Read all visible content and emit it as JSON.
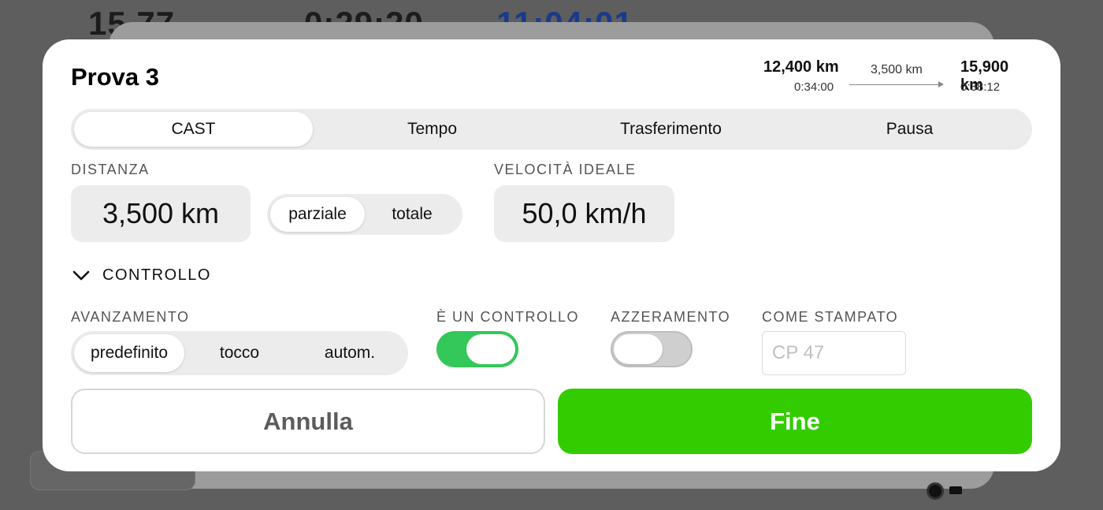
{
  "background": {
    "numbers": [
      "15,77",
      "0:29:20",
      "11:04:01"
    ]
  },
  "modal": {
    "title": "Prova 3",
    "route": {
      "from_km": "12,400 km",
      "from_time": "0:34:00",
      "segment_km": "3,500 km",
      "to_km": "15,900 km",
      "to_time": "0:38:12"
    },
    "tabs": [
      {
        "label": "CAST",
        "active": true
      },
      {
        "label": "Tempo",
        "active": false
      },
      {
        "label": "Trasferimento",
        "active": false
      },
      {
        "label": "Pausa",
        "active": false
      }
    ],
    "distance": {
      "label": "DISTANZA",
      "value": "3,500 km",
      "modes": [
        {
          "label": "parziale",
          "active": true
        },
        {
          "label": "totale",
          "active": false
        }
      ]
    },
    "ideal_speed": {
      "label": "VELOCITÀ IDEALE",
      "value": "50,0 km/h"
    },
    "control_section": {
      "label": "CONTROLLO",
      "chevron_icon": "chevron-down-icon",
      "advance": {
        "label": "AVANZAMENTO",
        "options": [
          {
            "label": "predefinito",
            "active": true
          },
          {
            "label": "tocco",
            "active": false
          },
          {
            "label": "autom.",
            "active": false
          }
        ]
      },
      "is_control": {
        "label": "È UN CONTROLLO",
        "on": true
      },
      "reset": {
        "label": "AZZERAMENTO",
        "on": false
      },
      "as_printed": {
        "label": "COME STAMPATO",
        "value": "",
        "placeholder": "CP 47"
      }
    },
    "buttons": {
      "cancel": "Annulla",
      "done": "Fine"
    },
    "colors": {
      "accent_green": "#33cc00",
      "toggle_on": "#34c759"
    }
  }
}
